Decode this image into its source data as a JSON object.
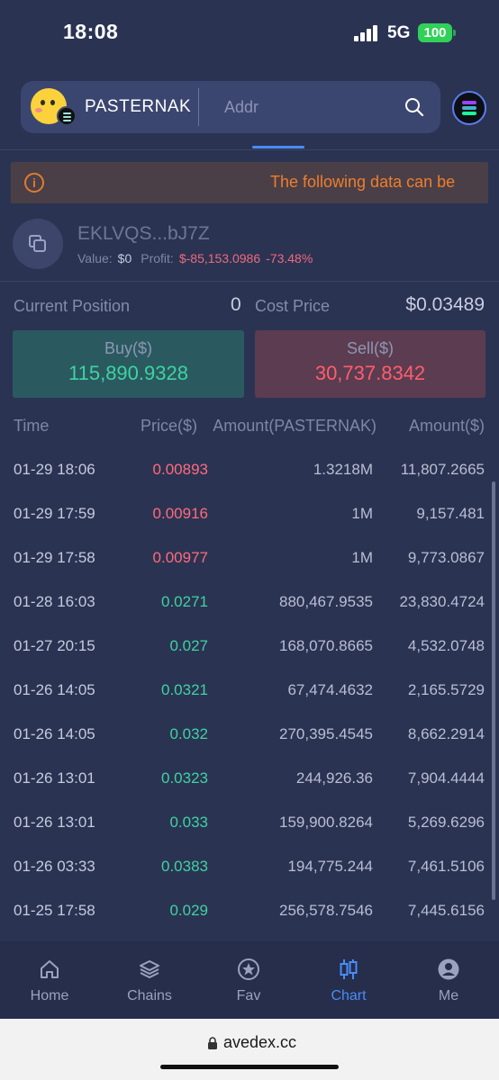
{
  "status_bar": {
    "time": "18:08",
    "network": "5G",
    "battery": "100"
  },
  "header": {
    "token_name": "PASTERNAK",
    "search_placeholder": "Addr",
    "icons": {
      "search": "search-icon",
      "chain": "solana-chain-icon"
    }
  },
  "alert": {
    "icon": "info-icon",
    "text": "The following data can be"
  },
  "wallet": {
    "address": "EKLVQS...bJ7Z",
    "value_label": "Value:",
    "value": "$0",
    "profit_label": "Profit:",
    "profit": "$-85,153.0986",
    "profit_pct": "-73.48%"
  },
  "position": {
    "current_label": "Current Position",
    "current_value": "0",
    "cost_label": "Cost Price",
    "cost_value": "$0.03489",
    "buy_label": "Buy($)",
    "buy_value": "115,890.9328",
    "sell_label": "Sell($)",
    "sell_value": "30,737.8342"
  },
  "table": {
    "headers": [
      "Time",
      "Price($)",
      "Amount(PASTERNAK)",
      "Amount($)"
    ],
    "rows": [
      {
        "time": "01-29 18:06",
        "price": "0.00893",
        "amount": "1.3218M",
        "usd": "11,807.2665",
        "side": "sell"
      },
      {
        "time": "01-29 17:59",
        "price": "0.00916",
        "amount": "1M",
        "usd": "9,157.481",
        "side": "sell"
      },
      {
        "time": "01-29 17:58",
        "price": "0.00977",
        "amount": "1M",
        "usd": "9,773.0867",
        "side": "sell"
      },
      {
        "time": "01-28 16:03",
        "price": "0.0271",
        "amount": "880,467.9535",
        "usd": "23,830.4724",
        "side": "buy"
      },
      {
        "time": "01-27 20:15",
        "price": "0.027",
        "amount": "168,070.8665",
        "usd": "4,532.0748",
        "side": "buy"
      },
      {
        "time": "01-26 14:05",
        "price": "0.0321",
        "amount": "67,474.4632",
        "usd": "2,165.5729",
        "side": "buy"
      },
      {
        "time": "01-26 14:05",
        "price": "0.032",
        "amount": "270,395.4545",
        "usd": "8,662.2914",
        "side": "buy"
      },
      {
        "time": "01-26 13:01",
        "price": "0.0323",
        "amount": "244,926.36",
        "usd": "7,904.4444",
        "side": "buy"
      },
      {
        "time": "01-26 13:01",
        "price": "0.033",
        "amount": "159,900.8264",
        "usd": "5,269.6296",
        "side": "buy"
      },
      {
        "time": "01-26 03:33",
        "price": "0.0383",
        "amount": "194,775.244",
        "usd": "7,461.5106",
        "side": "buy"
      },
      {
        "time": "01-25 17:58",
        "price": "0.029",
        "amount": "256,578.7546",
        "usd": "7,445.6156",
        "side": "buy"
      }
    ]
  },
  "nav": {
    "items": [
      {
        "label": "Home",
        "icon": "home-icon"
      },
      {
        "label": "Chains",
        "icon": "layers-icon"
      },
      {
        "label": "Fav",
        "icon": "star-icon"
      },
      {
        "label": "Chart",
        "icon": "candlestick-icon"
      },
      {
        "label": "Me",
        "icon": "user-icon"
      }
    ],
    "active": "Chart"
  },
  "colors": {
    "background": "#2b3353",
    "up": "#3ed3a0",
    "down": "#ff6b7a",
    "accent": "#4a8cf7",
    "warning": "#ef7d2c"
  },
  "browser": {
    "url": "avedex.cc"
  }
}
